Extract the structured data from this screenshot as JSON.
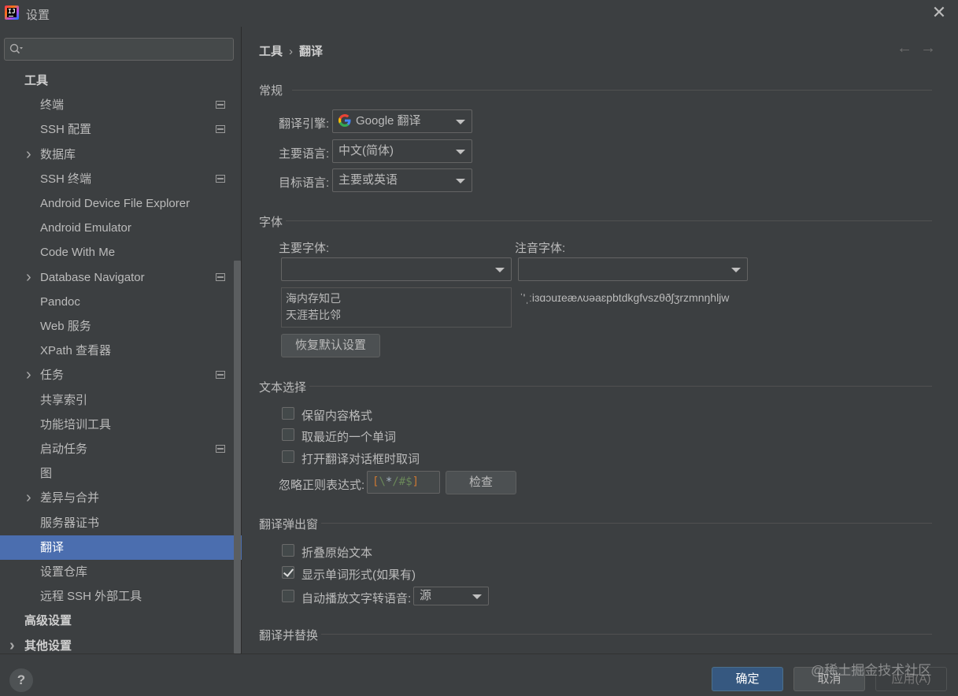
{
  "window": {
    "title": "设置"
  },
  "sidebar": {
    "search_placeholder": "",
    "items": [
      {
        "label": "工具",
        "level": 0,
        "chevron": false,
        "proj_icon": false,
        "selected": false
      },
      {
        "label": "终端",
        "level": 1,
        "chevron": false,
        "proj_icon": true,
        "selected": false
      },
      {
        "label": "SSH 配置",
        "level": 1,
        "chevron": false,
        "proj_icon": true,
        "selected": false
      },
      {
        "label": "数据库",
        "level": 1,
        "chevron": true,
        "proj_icon": false,
        "selected": false
      },
      {
        "label": "SSH 终端",
        "level": 1,
        "chevron": false,
        "proj_icon": true,
        "selected": false
      },
      {
        "label": "Android Device File Explorer",
        "level": 1,
        "chevron": false,
        "proj_icon": false,
        "selected": false
      },
      {
        "label": "Android Emulator",
        "level": 1,
        "chevron": false,
        "proj_icon": false,
        "selected": false
      },
      {
        "label": "Code With Me",
        "level": 1,
        "chevron": false,
        "proj_icon": false,
        "selected": false
      },
      {
        "label": "Database Navigator",
        "level": 1,
        "chevron": true,
        "proj_icon": true,
        "selected": false
      },
      {
        "label": "Pandoc",
        "level": 1,
        "chevron": false,
        "proj_icon": false,
        "selected": false
      },
      {
        "label": "Web 服务",
        "level": 1,
        "chevron": false,
        "proj_icon": false,
        "selected": false
      },
      {
        "label": "XPath 查看器",
        "level": 1,
        "chevron": false,
        "proj_icon": false,
        "selected": false
      },
      {
        "label": "任务",
        "level": 1,
        "chevron": true,
        "proj_icon": true,
        "selected": false
      },
      {
        "label": "共享索引",
        "level": 1,
        "chevron": false,
        "proj_icon": false,
        "selected": false
      },
      {
        "label": "功能培训工具",
        "level": 1,
        "chevron": false,
        "proj_icon": false,
        "selected": false
      },
      {
        "label": "启动任务",
        "level": 1,
        "chevron": false,
        "proj_icon": true,
        "selected": false
      },
      {
        "label": "图",
        "level": 1,
        "chevron": false,
        "proj_icon": false,
        "selected": false
      },
      {
        "label": "差异与合并",
        "level": 1,
        "chevron": true,
        "proj_icon": false,
        "selected": false
      },
      {
        "label": "服务器证书",
        "level": 1,
        "chevron": false,
        "proj_icon": false,
        "selected": false
      },
      {
        "label": "翻译",
        "level": 1,
        "chevron": false,
        "proj_icon": false,
        "selected": true
      },
      {
        "label": "设置仓库",
        "level": 1,
        "chevron": false,
        "proj_icon": false,
        "selected": false
      },
      {
        "label": "远程 SSH 外部工具",
        "level": 1,
        "chevron": false,
        "proj_icon": false,
        "selected": false
      },
      {
        "label": "高级设置",
        "level": 0,
        "chevron": false,
        "proj_icon": false,
        "selected": false
      },
      {
        "label": "其他设置",
        "level": 0,
        "chevron": true,
        "proj_icon": false,
        "selected": false
      }
    ]
  },
  "breadcrumb": {
    "parent": "工具",
    "separator": "›",
    "current": "翻译"
  },
  "nav": {
    "back": "←",
    "forward": "→"
  },
  "general": {
    "title": "常规",
    "engine_label": "翻译引擎:",
    "engine_value": "Google 翻译",
    "primary_lang_label": "主要语言:",
    "primary_lang_value": "中文(简体)",
    "target_lang_label": "目标语言:",
    "target_lang_value": "主要或英语"
  },
  "font": {
    "title": "字体",
    "primary_label": "主要字体:",
    "primary_value": "",
    "phonetic_label": "注音字体:",
    "phonetic_value": "",
    "preview_line1": "海内存知己",
    "preview_line2": "天涯若比邻",
    "phonetic_preview": "ˈ'ˌːiɜɑɔuɪeæʌʊəaɛpbtdkgfvszθðʃʒrzmnŋhljw",
    "reset_label": "恢复默认设置"
  },
  "selection": {
    "title": "文本选择",
    "keep_format": {
      "label": "保留内容格式",
      "checked": false
    },
    "nearest_word": {
      "label": "取最近的一个单词",
      "checked": false
    },
    "on_dialog_open": {
      "label": "打开翻译对话框时取词",
      "checked": false
    },
    "regex_label": "忽略正则表达式:",
    "regex_parts": [
      "[",
      "\\",
      "*",
      "/",
      "#",
      "$",
      "]"
    ],
    "check_label": "检查"
  },
  "popup": {
    "title": "翻译弹出窗",
    "fold_original": {
      "label": "折叠原始文本",
      "checked": false
    },
    "show_word_forms": {
      "label": "显示单词形式(如果有)",
      "checked": true
    },
    "auto_tts": {
      "label": "自动播放文字转语音:",
      "checked": false
    },
    "tts_source": "源"
  },
  "replace": {
    "title": "翻译并替换"
  },
  "footer": {
    "help": "?",
    "ok": "确定",
    "cancel": "取消",
    "apply": "应用(A)",
    "watermark": "@稀土掘金技术社区"
  },
  "colors": {
    "selection": "#4b6eaf",
    "ok_button": "#365880",
    "regex_bracket": "#cc7832",
    "regex_escape": "#6a8759",
    "regex_symbol": "#a9b7c6"
  }
}
